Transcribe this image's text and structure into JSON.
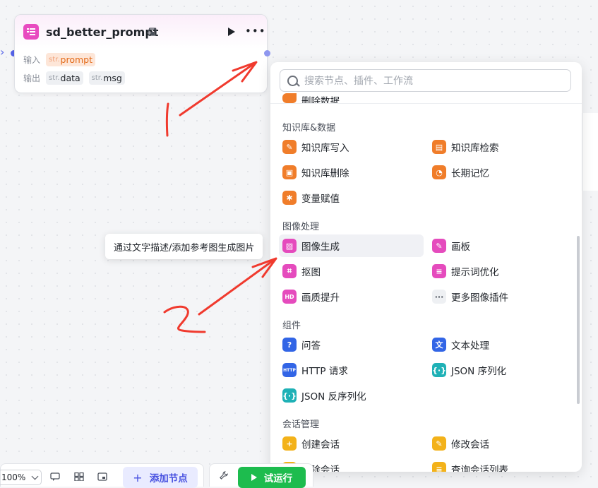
{
  "node": {
    "title": "sd_better_prompt",
    "input_label": "输入",
    "output_label": "输出",
    "inputs": [
      {
        "type": "str.",
        "name": "prompt"
      }
    ],
    "outputs": [
      {
        "type": "str.",
        "name": "data"
      },
      {
        "type": "str.",
        "name": "msg"
      }
    ]
  },
  "search": {
    "placeholder": "搜索节点、插件、工作流"
  },
  "sections": {
    "knowledge": "知识库&数据",
    "image": "图像处理",
    "component": "组件",
    "conversation": "会话管理"
  },
  "items": {
    "cut_data": "删除数据",
    "kb_write": "知识库写入",
    "kb_search": "知识库检索",
    "kb_delete": "知识库删除",
    "long_memory": "长期记忆",
    "var_assign": "变量赋值",
    "image_gen": "图像生成",
    "canvas": "画板",
    "cutout": "抠图",
    "prompt_opt": "提示词优化",
    "quality": "画质提升",
    "more_image": "更多图像插件",
    "qa": "问答",
    "text_proc": "文本处理",
    "http": "HTTP 请求",
    "json_ser": "JSON 序列化",
    "json_deser": "JSON 反序列化",
    "create_conv": "创建会话",
    "edit_conv": "修改会话",
    "delete_conv": "删除会话",
    "list_conv": "查询会话列表"
  },
  "tooltip": "通过文字描述/添加参考图生成图片",
  "annotations": {
    "one": "1",
    "two": "2"
  },
  "toolbar": {
    "zoom": "100%",
    "add_node": "添加节点",
    "try_run": "试运行"
  },
  "colors": {
    "orange": "#f07d2a",
    "pink": "#e54bbd",
    "blue": "#3265e6",
    "teal": "#1fb1b6",
    "yellow": "#f3b21a",
    "green": "#1dbc4e"
  }
}
